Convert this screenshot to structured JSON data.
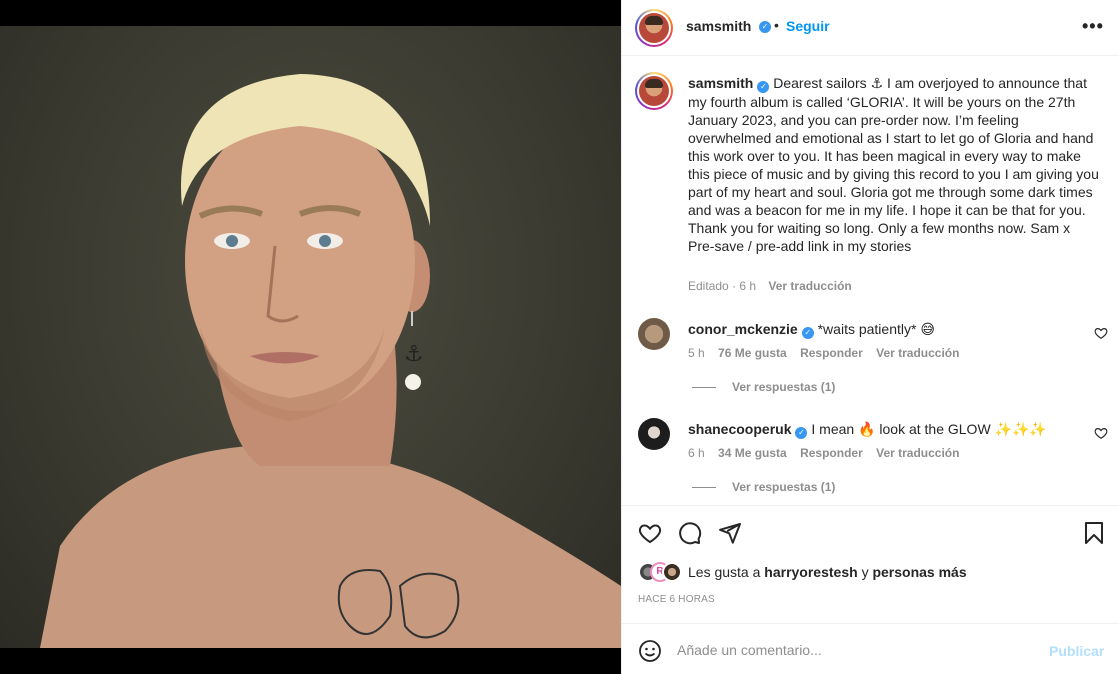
{
  "post": {
    "username": "samsmith",
    "follow_label": "Seguir",
    "separator": "•",
    "more_label": "•••"
  },
  "caption": {
    "username": "samsmith",
    "text": "Dearest sailors ⚓ I am overjoyed to announce that my fourth album is called ‘GLORIA’. It will be yours on the 27th January 2023, and you can pre-order now. I’m feeling overwhelmed and emotional as I start to let go of Gloria and hand this work over to you. It has been magical in every way to make this piece of music and by giving this record to you I am giving you part of my heart and soul. Gloria got me through some dark times and was a beacon for me in my life. I hope it can be that for you. Thank you for waiting so long. Only a few months now. Sam x",
    "text2": "Pre-save / pre-add link in my stories",
    "edited": "Editado · 6 h",
    "translate": "Ver traducción"
  },
  "comments": [
    {
      "username": "conor_mckenzie",
      "text": "*waits patiently* 😅",
      "time": "5 h",
      "likes": "76 Me gusta",
      "reply": "Responder",
      "translate": "Ver traducción",
      "replies": "Ver respuestas (1)"
    },
    {
      "username": "shanecooperuk",
      "text": "I mean 🔥 look at the GLOW ✨✨✨",
      "time": "6 h",
      "likes": "34 Me gusta",
      "reply": "Responder",
      "translate": "Ver traducción",
      "replies": "Ver respuestas (1)"
    }
  ],
  "likes": {
    "prefix": "Les gusta a",
    "user": "harryorestesh",
    "conj": "y",
    "others": "personas más",
    "mini_letter": "R"
  },
  "timestamp": "HACE 6 HORAS",
  "comment_box": {
    "placeholder": "Añade un comentario...",
    "publish": "Publicar"
  },
  "icons": {
    "like": "heart-icon",
    "comment": "comment-icon",
    "share": "share-icon",
    "save": "bookmark-icon",
    "emoji": "emoji-icon"
  },
  "colors": {
    "accent": "#0095f6",
    "publish_disabled": "#b2dffc",
    "verified": "#3897f0",
    "muted": "#8e8e8e"
  }
}
